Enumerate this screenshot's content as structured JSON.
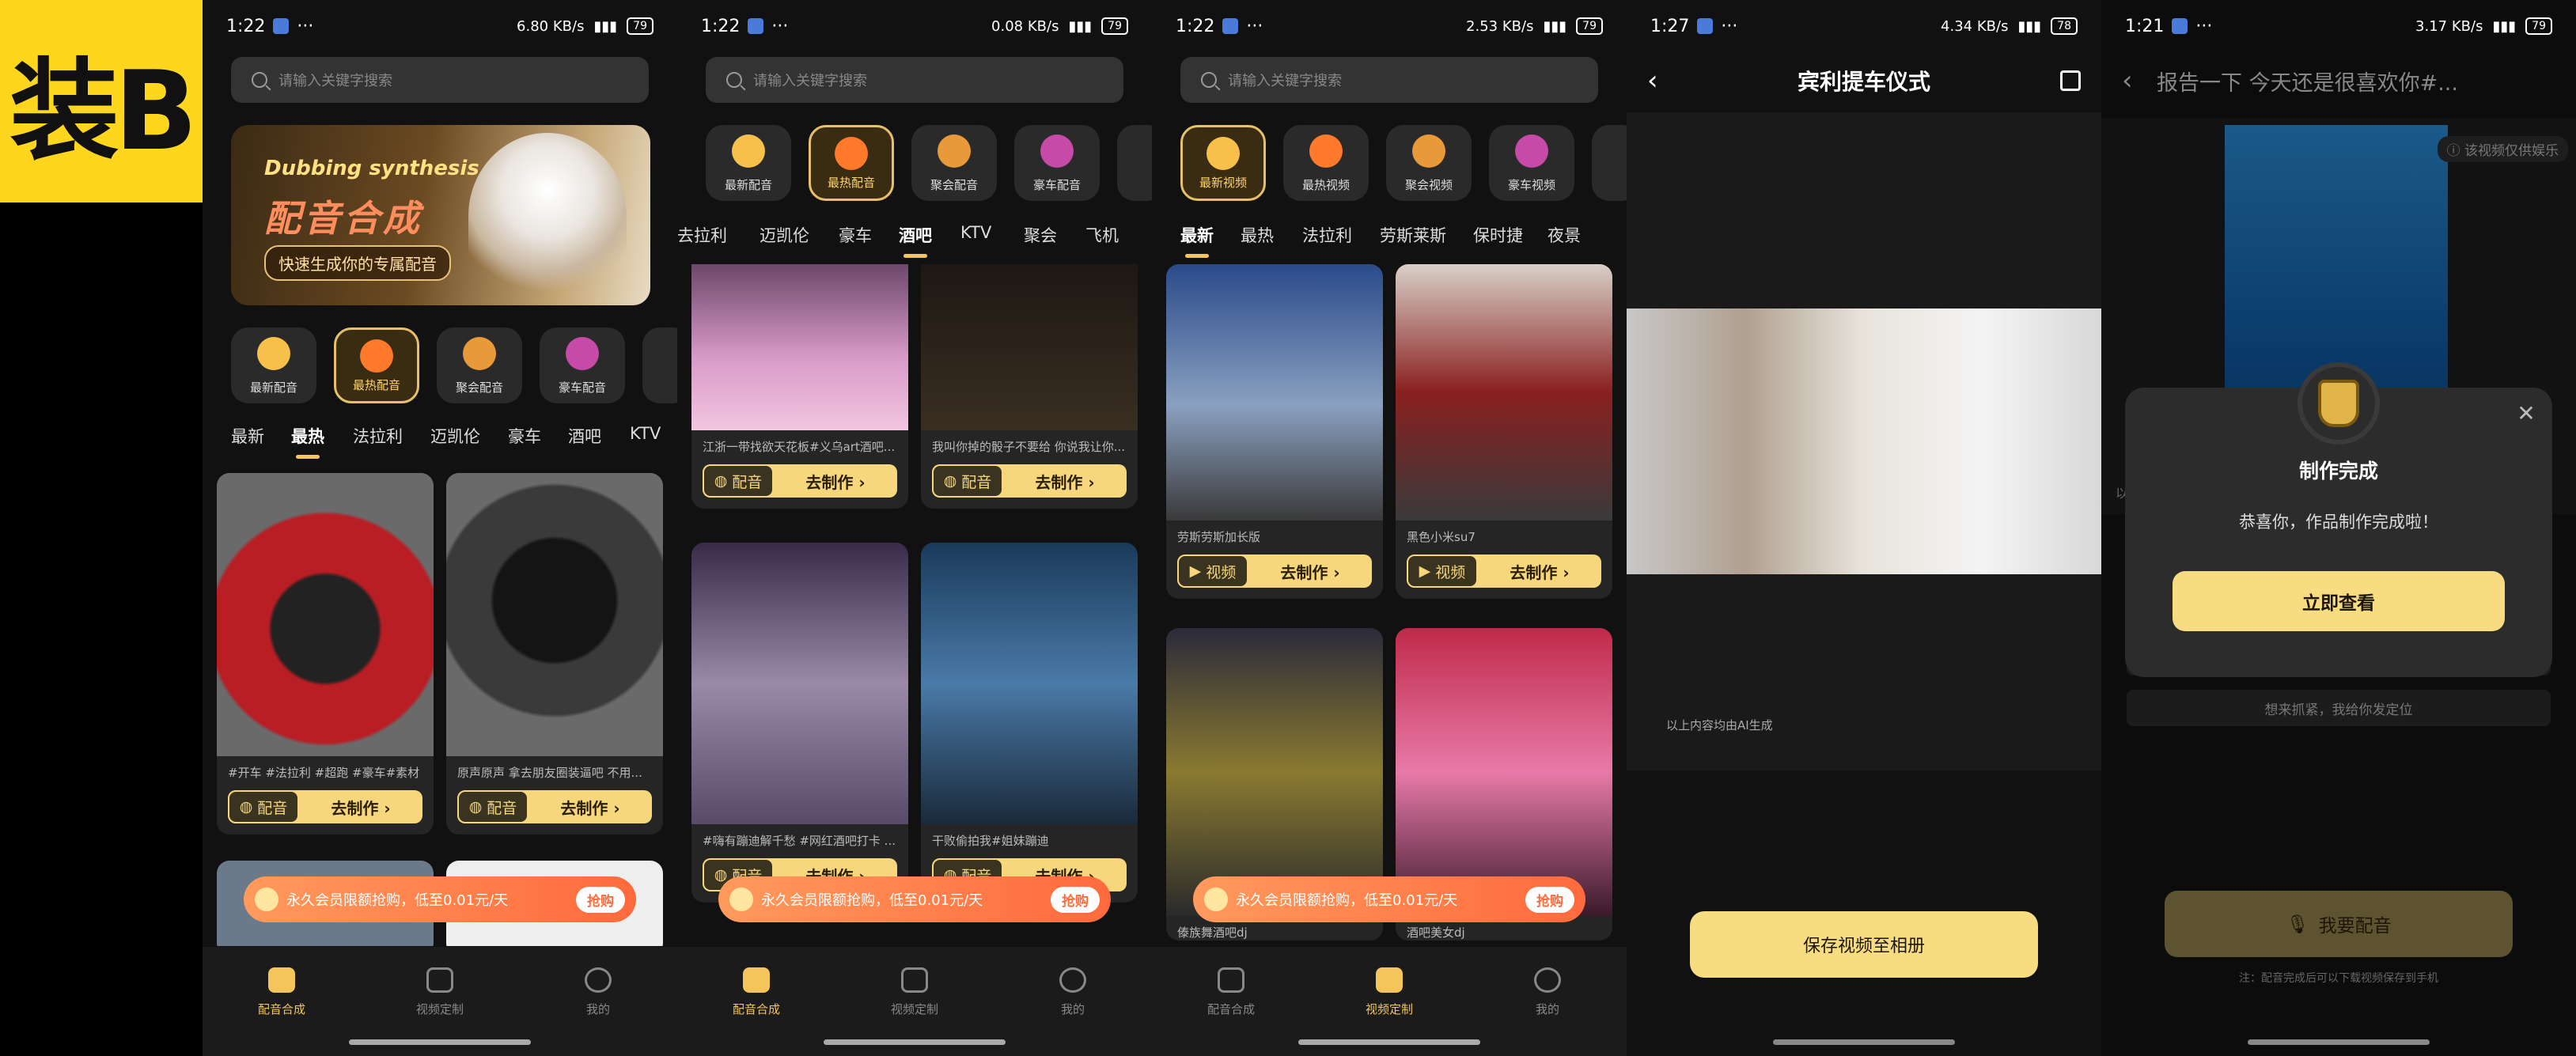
{
  "badge_text": "装B",
  "status": {
    "p1": {
      "time": "1:22",
      "net": "6.80 KB/s",
      "batt": "79"
    },
    "p2": {
      "time": "1:22",
      "net": "0.08 KB/s",
      "batt": "79"
    },
    "p3": {
      "time": "1:22",
      "net": "2.53 KB/s",
      "batt": "79"
    },
    "p4": {
      "time": "1:27",
      "net": "4.34 KB/s",
      "batt": "78"
    },
    "p5": {
      "time": "1:21",
      "net": "3.17 KB/s",
      "batt": "79"
    }
  },
  "search_placeholder": "请输入关键字搜索",
  "banner": {
    "en": "Dubbing synthesis",
    "cn": "配音合成",
    "pill": "快速生成你的专属配音"
  },
  "audio_cats": [
    "最新配音",
    "最热配音",
    "聚会配音",
    "豪车配音"
  ],
  "video_cats": [
    "最新视频",
    "最热视频",
    "聚会视频",
    "豪车视频"
  ],
  "p1_tabs": [
    "最新",
    "最热",
    "法拉利",
    "迈凯伦",
    "豪车",
    "酒吧",
    "KTV"
  ],
  "p2_tabs": [
    "去拉利",
    "迈凯伦",
    "豪车",
    "酒吧",
    "KTV",
    "聚会",
    "飞机"
  ],
  "p3_tabs": [
    "最新",
    "最热",
    "法拉利",
    "劳斯莱斯",
    "保时捷",
    "夜景"
  ],
  "p1_cards": [
    {
      "cap": "#开车 #法拉利 #超跑 #豪车#素材",
      "color": "#9e2a2a"
    },
    {
      "cap": "原声原声 拿去朋友圈装逼吧 不用...",
      "color": "#3a3a3a"
    }
  ],
  "p2_cards": [
    {
      "cap": "江浙一带找欲天花板#义乌art酒吧...",
      "color": "#c88ab8"
    },
    {
      "cap": "我叫你掉的骰子不要给 你说我让你...",
      "color": "#2a241e"
    },
    {
      "cap": "#嗨有蹦迪解千愁 #网红酒吧打卡 ...",
      "color": "#6b5a7a"
    },
    {
      "cap": "干败偷拍我#姐妹蹦迪",
      "color": "#2c4a6a"
    }
  ],
  "p3_cards": [
    {
      "cap": "劳斯劳斯加长版",
      "color": "#3a5a8a"
    },
    {
      "cap": "黑色小米su7",
      "color": "#8a7a70"
    },
    {
      "cap": "傣族舞酒吧dj",
      "color": "#6a5a30"
    },
    {
      "cap": "酒吧美女dj",
      "color": "#a83a6a"
    }
  ],
  "card_actions": {
    "audio": "配音",
    "video": "视频",
    "make": "去制作"
  },
  "promo": {
    "text": "永久会员限额抢购，低至0.01元/天",
    "btn": "抢购"
  },
  "nav": [
    "配音合成",
    "视频定制",
    "我的"
  ],
  "p4": {
    "title": "宾利提车仪式",
    "ai_note": "以上内容均由AI生成",
    "save": "保存视频至相册"
  },
  "p5": {
    "title": "报告一下 今天还是很喜欢你#...",
    "note": "该视频仅供娱乐",
    "side": "以上",
    "modal_title": "制作完成",
    "modal_msg": "恭喜你，作品制作完成啦！",
    "modal_btn": "立即查看",
    "row_text": "想来抓紧，我给你发定位",
    "dub_btn": "我要配音",
    "foot": "注：配音完成后可以下载视频保存到手机"
  }
}
